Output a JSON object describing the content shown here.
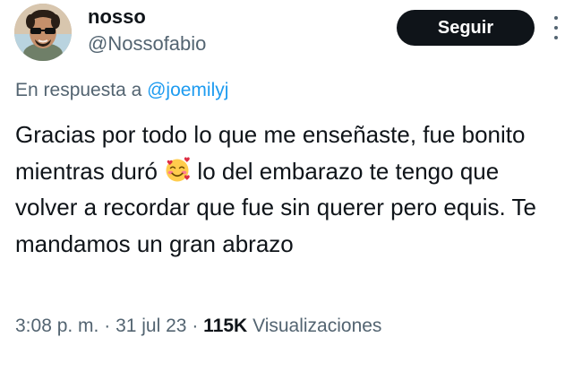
{
  "author": {
    "name": "nosso",
    "handle": "@Nossofabio",
    "avatar_icon": "person-with-sunglasses-avatar"
  },
  "follow_button": {
    "label": "Seguir"
  },
  "more_menu": {
    "icon": "vertical-ellipsis-icon"
  },
  "reply": {
    "prefix": "En respuesta a ",
    "mention": "@joemilyj"
  },
  "tweet": {
    "text_before_emoji": "Gracias por todo lo que me enseñaste, fue bonito mientras duró ",
    "emoji": "smiling-face-with-hearts-emoji",
    "text_after_emoji": " lo del embarazo te tengo que volver a recordar que fue sin querer pero equis. Te mandamos un gran abrazo"
  },
  "meta": {
    "time": "3:08 p. m.",
    "separator": "·",
    "date": "31 jul 23",
    "views_count": "115K",
    "views_label": "Visualizaciones"
  },
  "colors": {
    "text": "#0f1419",
    "secondary": "#536471",
    "link": "#1d9bf0",
    "button_bg": "#0f1419",
    "button_text": "#ffffff"
  }
}
